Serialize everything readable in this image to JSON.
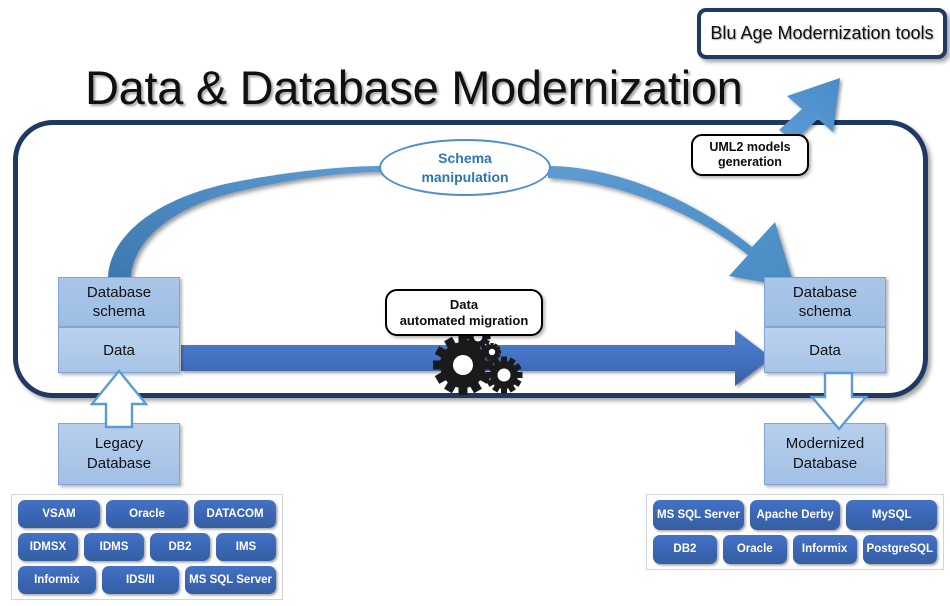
{
  "title": "Data & Database Modernization",
  "tools_box": {
    "label": "Blu Age Modernization tools"
  },
  "callouts": {
    "uml2": {
      "line1": "UML2 models",
      "line2": "generation"
    },
    "migration": {
      "line1": "Data",
      "line2": "automated migration"
    },
    "schema_manipulation": {
      "line1": "Schema",
      "line2": "manipulation"
    }
  },
  "source": {
    "schema_label_line1": "Database",
    "schema_label_line2": "schema",
    "data_label": "Data",
    "base_label_line1": "Legacy",
    "base_label_line2": "Database"
  },
  "target": {
    "schema_label_line1": "Database",
    "schema_label_line2": "schema",
    "data_label": "Data",
    "base_label_line1": "Modernized",
    "base_label_line2": "Database"
  },
  "legend_left": {
    "rows": [
      [
        "VSAM",
        "Oracle",
        "DATACOM"
      ],
      [
        "IDMSX",
        "IDMS",
        "DB2",
        "IMS"
      ],
      [
        "Informix",
        "IDS/II",
        "MS SQL Server"
      ]
    ]
  },
  "legend_right": {
    "rows": [
      [
        "MS SQL Server",
        "Apache Derby",
        "MySQL"
      ],
      [
        "DB2",
        "Oracle",
        "Informix",
        "PostgreSQL"
      ]
    ]
  },
  "colors": {
    "frame_navy": "#1F3864",
    "accent_blue": "#4472C4",
    "light_blue": "#5B9BD5",
    "schema_text": "#2E75B6",
    "chip_blue": "#4472C4",
    "box_fill": "#A9C6E8"
  },
  "icons": {
    "gears": "gears-icon",
    "arrow_up_left": "block-arrow-up-icon",
    "arrow_down_right": "block-arrow-down-icon",
    "migration_arrow": "right-arrow-icon",
    "schema_curve": "curved-arrow-icon",
    "tools_arrow": "diagonal-arrow-up-icon"
  }
}
